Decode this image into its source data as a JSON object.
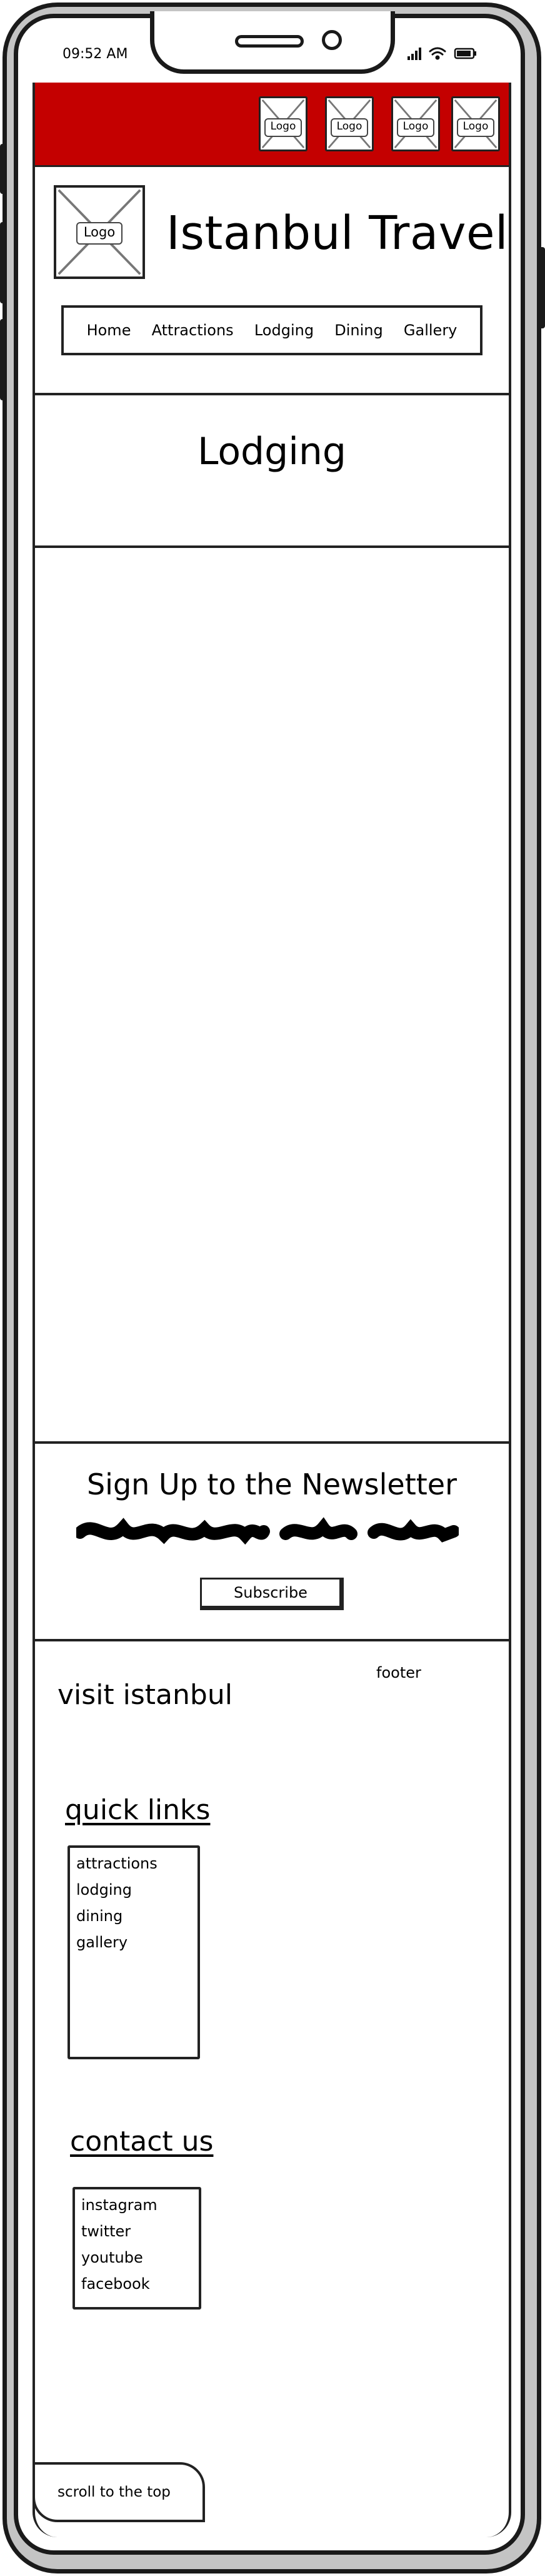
{
  "status_bar": {
    "time": "09:52 AM"
  },
  "top_bar": {
    "color": "#c40000",
    "logos": [
      "Logo",
      "Logo",
      "Logo",
      "Logo"
    ]
  },
  "header": {
    "logo_label": "Logo",
    "title": "Istanbul Travel"
  },
  "nav": {
    "items": [
      "Home",
      "Attractions",
      "Lodging",
      "Dining",
      "Gallery"
    ]
  },
  "page": {
    "heading": "Lodging"
  },
  "newsletter": {
    "title": "Sign Up to the Newsletter",
    "button": "Subscribe"
  },
  "footer": {
    "label": "footer",
    "visit": "visit istanbul",
    "quick_links": {
      "title": "quick links",
      "items": [
        "attractions",
        "lodging",
        "dining",
        "gallery"
      ]
    },
    "contact": {
      "title": "contact us",
      "items": [
        "instagram",
        "twitter",
        "youtube",
        "facebook"
      ]
    }
  },
  "scroll_top": "scroll to the top"
}
